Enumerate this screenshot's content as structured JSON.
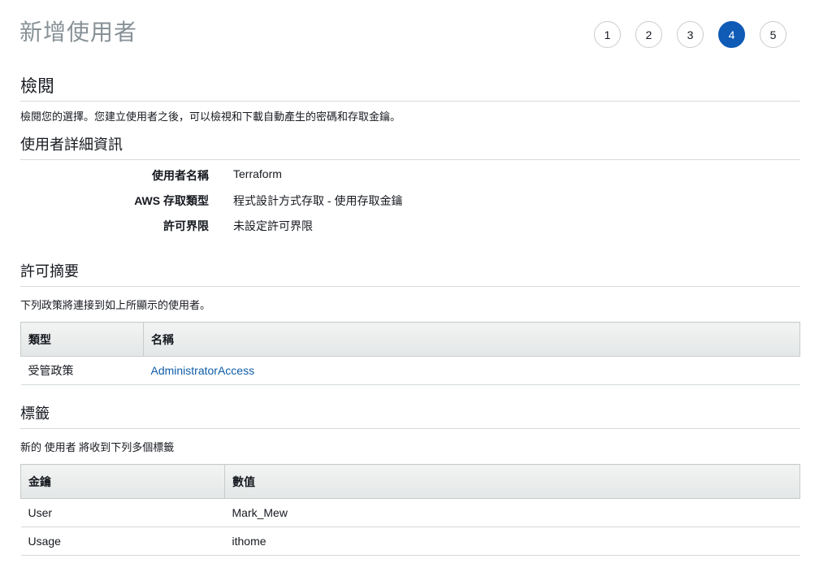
{
  "header": {
    "title": "新增使用者",
    "steps": [
      "1",
      "2",
      "3",
      "4",
      "5"
    ],
    "active_step": 4
  },
  "review": {
    "heading": "檢閱",
    "description": "檢閱您的選擇。您建立使用者之後，可以檢視和下載自動產生的密碼和存取金鑰。"
  },
  "user_details": {
    "heading": "使用者詳細資訊",
    "rows": [
      {
        "label": "使用者名稱",
        "value": "Terraform"
      },
      {
        "label": "AWS 存取類型",
        "value": "程式設計方式存取 - 使用存取金鑰"
      },
      {
        "label": "許可界限",
        "value": "未設定許可界限"
      }
    ]
  },
  "permissions": {
    "heading": "許可摘要",
    "description": "下列政策將連接到如上所顯示的使用者。",
    "columns": [
      "類型",
      "名稱"
    ],
    "rows": [
      {
        "type": "受管政策",
        "name": "AdministratorAccess"
      }
    ]
  },
  "tags": {
    "heading": "標籤",
    "description": "新的 使用者 將收到下列多個標籤",
    "columns": [
      "金鑰",
      "數值"
    ],
    "rows": [
      {
        "key": "User",
        "value": "Mark_Mew"
      },
      {
        "key": "Usage",
        "value": "ithome"
      }
    ]
  },
  "colors": {
    "accent": "#0f5bb5",
    "link": "#0e5ca8",
    "title_gray": "#879196"
  }
}
